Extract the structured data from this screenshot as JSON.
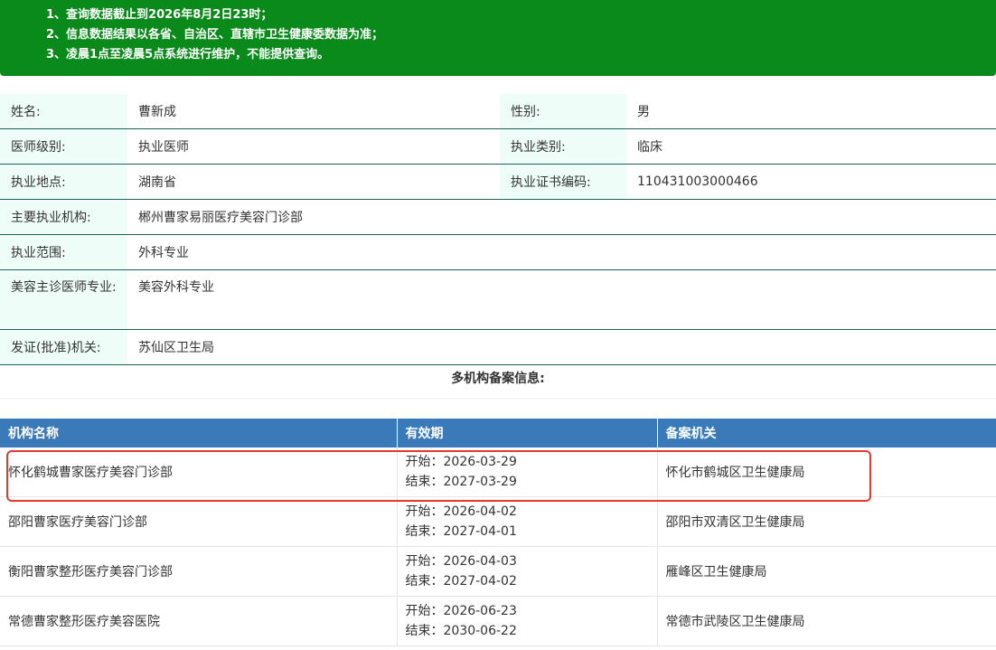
{
  "notice": [
    "1、查询数据截止到2026年8月2日23时；",
    "2、信息数据结果以各省、自治区、直辖市卫生健康委数据为准；",
    "3、凌晨1点至凌晨5点系统进行维护，不能提供查询。"
  ],
  "doctor": {
    "name_label": "姓名:",
    "name": "曹新成",
    "gender_label": "性别:",
    "gender": "男",
    "level_label": "医师级别:",
    "level": "执业医师",
    "category_label": "执业类别:",
    "category": "临床",
    "location_label": "执业地点:",
    "location": "湖南省",
    "cert_label": "执业证书编码:",
    "cert": "110431003000466",
    "org_label": "主要执业机构:",
    "org": "郴州曹家易丽医疗美容门诊部",
    "scope_label": "执业范围:",
    "scope": "外科专业",
    "cosmetic_label": "美容主诊医师专业:",
    "cosmetic": "美容外科专业",
    "issuer_label": "发证(批准)机关:",
    "issuer": "苏仙区卫生局"
  },
  "multi_title": "多机构备案信息:",
  "institutions": {
    "headers": [
      "机构名称",
      "有效期",
      "备案机关"
    ],
    "rows": [
      {
        "name": "怀化鹤城曹家医疗美容门诊部",
        "start": "开始：2026-03-29",
        "end": "结束：2027-03-29",
        "authority": "怀化市鹤城区卫生健康局"
      },
      {
        "name": "邵阳曹家医疗美容门诊部",
        "start": "开始：2026-04-02",
        "end": "结束：2027-04-01",
        "authority": "邵阳市双清区卫生健康局"
      },
      {
        "name": "衡阳曹家整形医疗美容门诊部",
        "start": "开始：2026-04-03",
        "end": "结束：2027-04-02",
        "authority": "雁峰区卫生健康局"
      },
      {
        "name": "常德曹家整形医疗美容医院",
        "start": "开始：2026-06-23",
        "end": "结束：2030-06-22",
        "authority": "常德市武陵区卫生健康局"
      }
    ]
  },
  "colors": {
    "notice_bg": "#0a8a1b",
    "header_bg": "#3a7ab9",
    "label_bg": "#effdf8",
    "highlight": "#e53a2b"
  }
}
